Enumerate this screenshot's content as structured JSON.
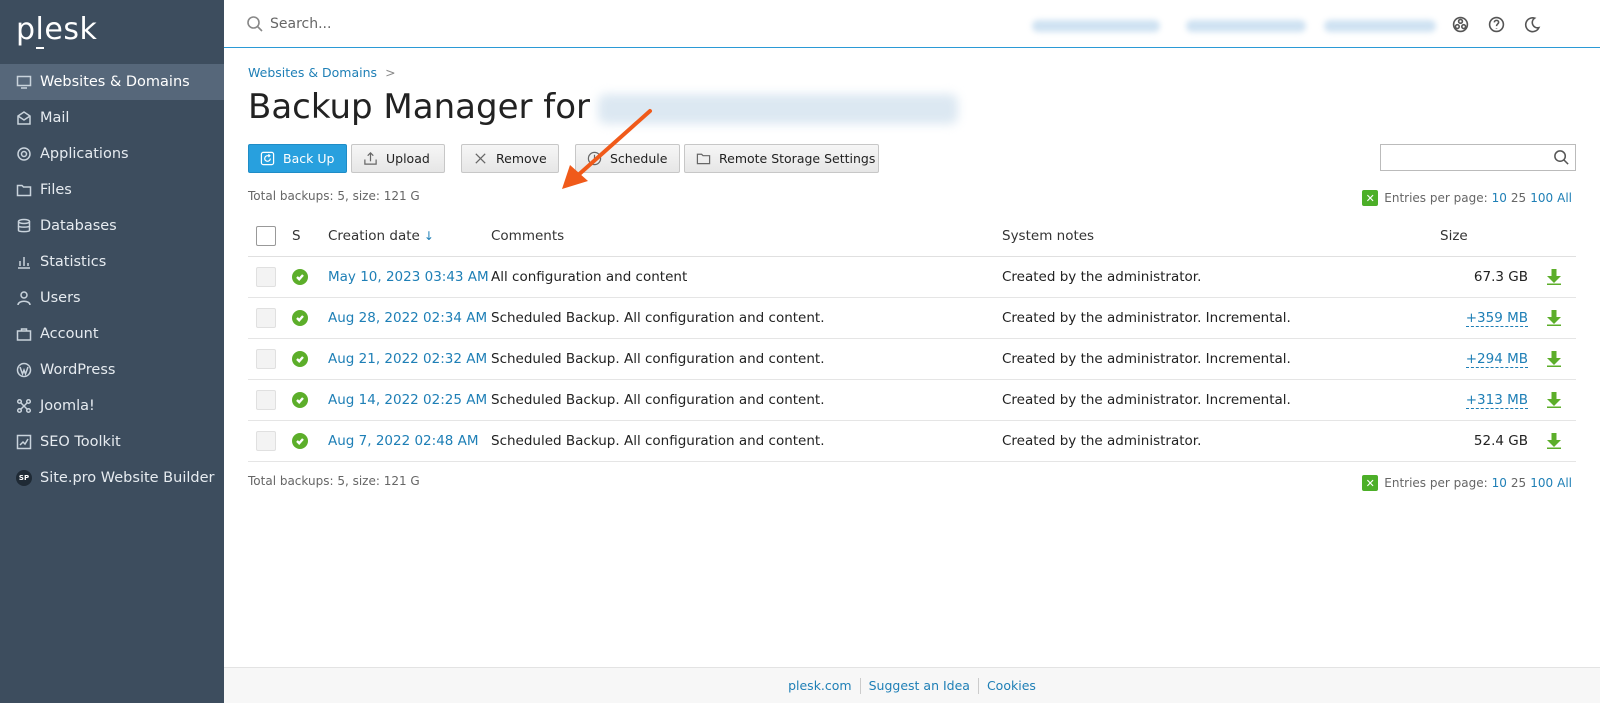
{
  "app": {
    "logo": "plesk"
  },
  "sidebar": {
    "items": [
      {
        "label": "Websites & Domains",
        "icon": "monitor-icon",
        "active": true
      },
      {
        "label": "Mail",
        "icon": "mail-icon"
      },
      {
        "label": "Applications",
        "icon": "gear-icon"
      },
      {
        "label": "Files",
        "icon": "folder-icon"
      },
      {
        "label": "Databases",
        "icon": "database-icon"
      },
      {
        "label": "Statistics",
        "icon": "bar-chart-icon"
      },
      {
        "label": "Users",
        "icon": "user-icon"
      },
      {
        "label": "Account",
        "icon": "briefcase-icon"
      },
      {
        "label": "WordPress",
        "icon": "wordpress-icon"
      },
      {
        "label": "Joomla!",
        "icon": "joomla-icon"
      },
      {
        "label": "SEO Toolkit",
        "icon": "seo-icon"
      },
      {
        "label": "Site.pro Website Builder",
        "icon": "sitepro-icon",
        "badge": "SP"
      }
    ]
  },
  "topbar": {
    "search_placeholder": "Search..."
  },
  "breadcrumb": {
    "item": "Websites & Domains",
    "separator": ">"
  },
  "page": {
    "title": "Backup Manager for"
  },
  "toolbar": {
    "back_up": "Back Up",
    "upload": "Upload",
    "remove": "Remove",
    "schedule": "Schedule",
    "remote_storage": "Remote Storage Settings"
  },
  "summary": {
    "total": "Total backups: 5, size: 121 G",
    "entries_label": "Entries per page:",
    "entries_options": [
      "10",
      "25",
      "100",
      "All"
    ]
  },
  "table": {
    "headers": {
      "status": "S",
      "creation_date": "Creation date",
      "comments": "Comments",
      "system_notes": "System notes",
      "size": "Size"
    },
    "rows": [
      {
        "date": "May 10, 2023 03:43 AM",
        "comment": "All configuration and content",
        "notes": "Created by the administrator.",
        "size": "67.3 GB",
        "size_link": false
      },
      {
        "date": "Aug 28, 2022 02:34 AM",
        "comment": "Scheduled Backup. All configuration and content.",
        "notes": "Created by the administrator. Incremental.",
        "size": "+359 MB",
        "size_link": true
      },
      {
        "date": "Aug 21, 2022 02:32 AM",
        "comment": "Scheduled Backup. All configuration and content.",
        "notes": "Created by the administrator. Incremental.",
        "size": "+294 MB",
        "size_link": true
      },
      {
        "date": "Aug 14, 2022 02:25 AM",
        "comment": "Scheduled Backup. All configuration and content.",
        "notes": "Created by the administrator. Incremental.",
        "size": "+313 MB",
        "size_link": true
      },
      {
        "date": "Aug 7, 2022 02:48 AM",
        "comment": "Scheduled Backup. All configuration and content.",
        "notes": "Created by the administrator.",
        "size": "52.4 GB",
        "size_link": false
      }
    ]
  },
  "footer": {
    "links": [
      "plesk.com",
      "Suggest an Idea",
      "Cookies"
    ]
  },
  "colors": {
    "sidebar_bg": "#3d4d5e",
    "accent": "#28a0de",
    "link": "#1e7fb6",
    "success": "#5cae2a",
    "annotation_arrow": "#f05a1a"
  }
}
